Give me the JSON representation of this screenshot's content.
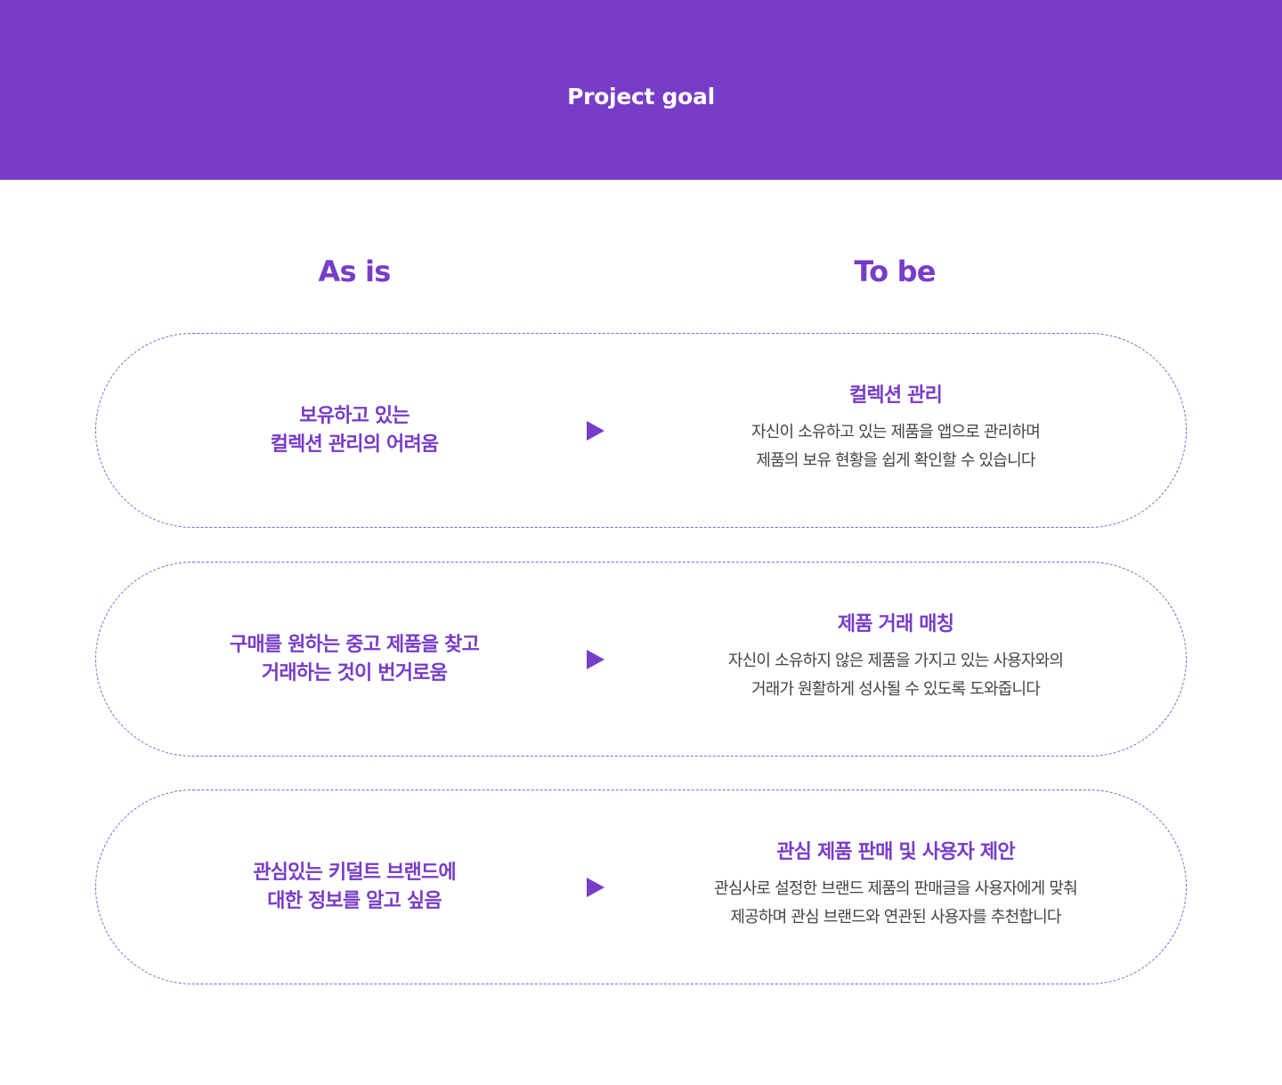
{
  "header": {
    "title": "Project goal"
  },
  "columns": {
    "as_is": "As is",
    "to_be": "To be"
  },
  "rows": [
    {
      "problem": "보유하고 있는\n컬렉션 관리의 어려움",
      "goal_title": "컬렉션 관리",
      "goal_desc": "자신이 소유하고 있는 제품을 앱으로 관리하며\n제품의 보유 현황을 쉽게 확인할 수 있습니다"
    },
    {
      "problem": "구매를 원하는 중고 제품을 찾고\n거래하는 것이 번거로움",
      "goal_title": "제품 거래 매칭",
      "goal_desc": "자신이 소유하지 않은 제품을 가지고 있는 사용자와의\n거래가 원활하게 성사될 수 있도록 도와줍니다"
    },
    {
      "problem": "관심있는 키덜트 브랜드에\n대한 정보를 알고 싶음",
      "goal_title": "관심 제품 판매 및 사용자 제안",
      "goal_desc": "관심사로 설정한 브랜드 제품의 판매글을 사용자에게 맞춰\n제공하며 관심 브랜드와 연관된 사용자를 추천합니다"
    }
  ],
  "icons": {
    "arrow": "play-triangle-right-icon"
  },
  "colors": {
    "brand": "#773cc8",
    "text": "#444444",
    "background": "#ffffff"
  }
}
